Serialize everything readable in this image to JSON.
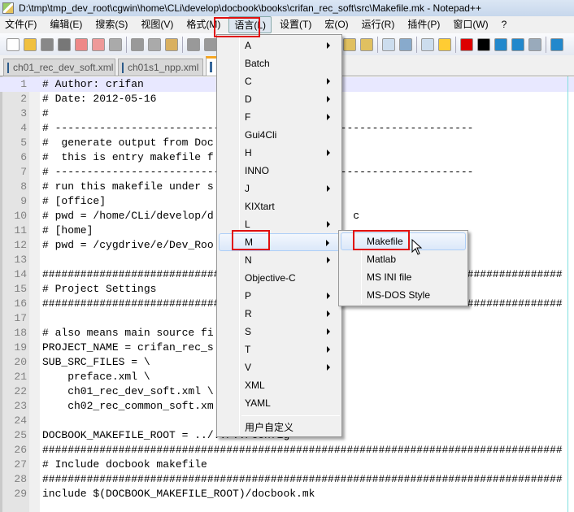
{
  "window": {
    "title": "D:\\tmp\\tmp_dev_root\\cgwin\\home\\CLi\\develop\\docbook\\books\\crifan_rec_soft\\src\\Makefile.mk - Notepad++"
  },
  "menubar": [
    "文件(F)",
    "编辑(E)",
    "搜索(S)",
    "视图(V)",
    "格式(M)",
    "语言(L)",
    "设置(T)",
    "宏(O)",
    "运行(R)",
    "插件(P)",
    "窗口(W)",
    "?"
  ],
  "active_menu": "语言(L)",
  "tabs": [
    {
      "label": "ch01_rec_dev_soft.xml"
    },
    {
      "label": "ch01s1_npp.xml"
    },
    {
      "label": ""
    }
  ],
  "editor": {
    "current_line": 1,
    "lines": [
      "# Author: crifan",
      "# Date: 2012-05-16",
      "#",
      "# ------------------------------------------------------------------",
      "#  generate output from Doc",
      "#  this is entry makefile f",
      "# ------------------------------------------------------------------",
      "# run this makefile under s",
      "# [office]",
      "# pwd = /home/CLi/develop/d                      c",
      "# [home]",
      "# pwd = /cygdrive/e/Dev_Roo",
      "",
      "##################################################################################",
      "# Project Settings",
      "##################################################################################",
      "",
      "# also means main source fi",
      "PROJECT_NAME = crifan_rec_s",
      "SUB_SRC_FILES = \\",
      "    preface.xml \\",
      "    ch01_rec_dev_soft.xml \\",
      "    ch02_rec_common_soft.xm",
      "",
      "DOCBOOK_MAKEFILE_ROOT = ../../../config",
      "##################################################################################",
      "# Include docbook makefile",
      "##################################################################################",
      "include $(DOCBOOK_MAKEFILE_ROOT)/docbook.mk"
    ]
  },
  "language_menu": {
    "items": [
      {
        "label": "A",
        "submenu": true
      },
      {
        "label": "Batch",
        "submenu": false
      },
      {
        "label": "C",
        "submenu": true
      },
      {
        "label": "D",
        "submenu": true
      },
      {
        "label": "F",
        "submenu": true
      },
      {
        "label": "Gui4Cli",
        "submenu": false
      },
      {
        "label": "H",
        "submenu": true
      },
      {
        "label": "INNO",
        "submenu": false
      },
      {
        "label": "J",
        "submenu": true
      },
      {
        "label": "KIXtart",
        "submenu": false
      },
      {
        "label": "L",
        "submenu": true
      },
      {
        "label": "M",
        "submenu": true,
        "highlighted": true
      },
      {
        "label": "N",
        "submenu": true
      },
      {
        "label": "Objective-C",
        "submenu": false
      },
      {
        "label": "P",
        "submenu": true
      },
      {
        "label": "R",
        "submenu": true
      },
      {
        "label": "S",
        "submenu": true
      },
      {
        "label": "T",
        "submenu": true
      },
      {
        "label": "V",
        "submenu": true
      },
      {
        "label": "XML",
        "submenu": false
      },
      {
        "label": "YAML",
        "submenu": false
      }
    ],
    "user_defined": "用户自定义"
  },
  "m_submenu": {
    "items": [
      {
        "label": "Makefile",
        "highlighted": true
      },
      {
        "label": "Matlab"
      },
      {
        "label": "MS INI file"
      },
      {
        "label": "MS-DOS Style"
      }
    ]
  },
  "colors": {
    "highlight_box": "#e01010",
    "current_line": "#e8e8ff",
    "gutter": "#e4e4e4"
  }
}
